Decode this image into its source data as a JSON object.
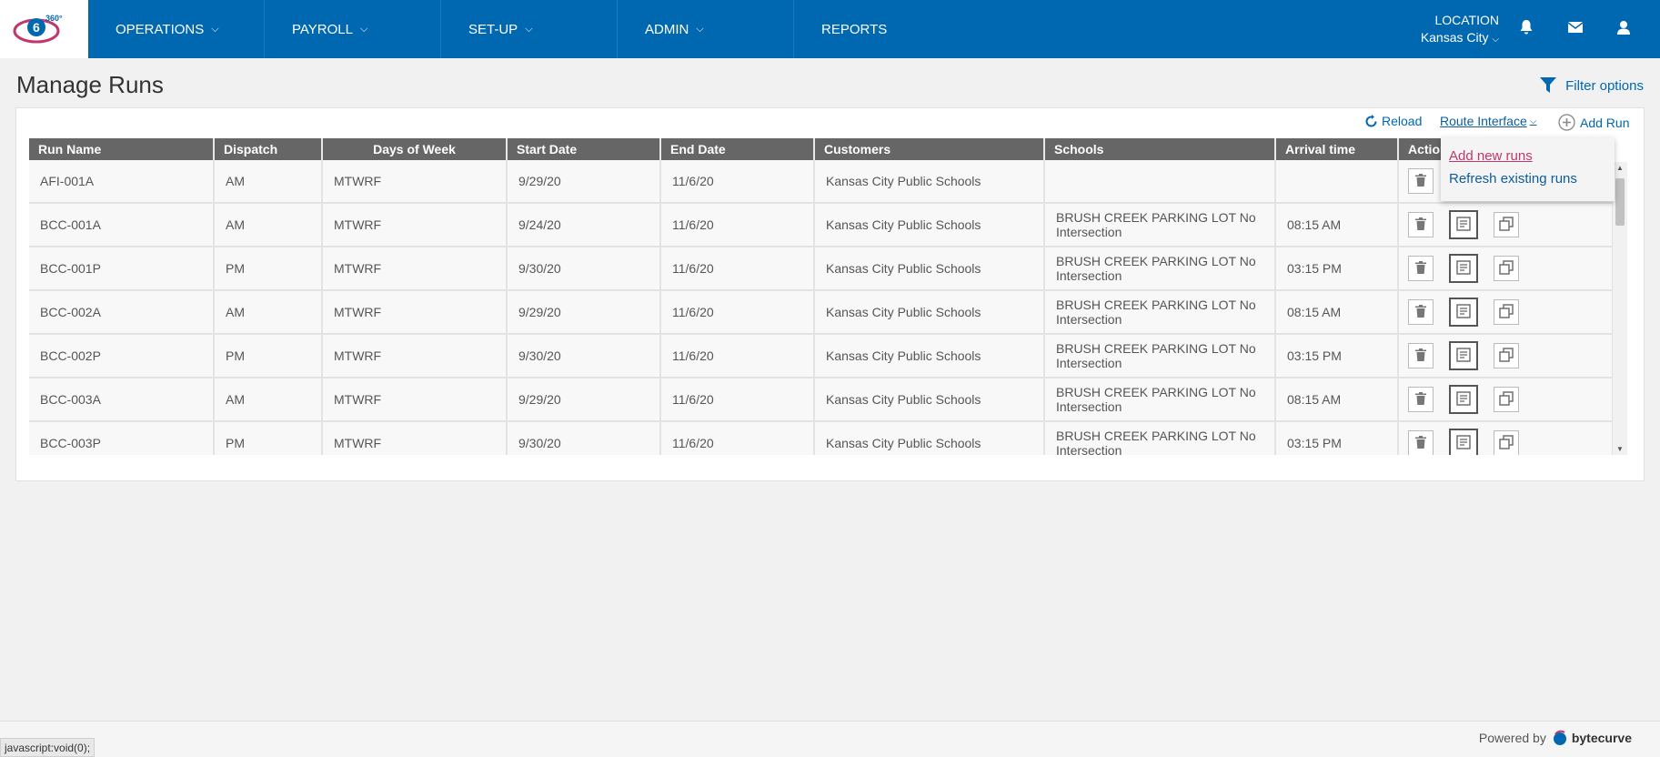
{
  "nav": {
    "items": [
      {
        "label": "OPERATIONS",
        "chevron": "⌄"
      },
      {
        "label": "PAYROLL",
        "chevron": "⌄"
      },
      {
        "label": "SET-UP",
        "chevron": "⌄"
      },
      {
        "label": "ADMIN",
        "chevron": "⌄"
      },
      {
        "label": "REPORTS",
        "chevron": ""
      }
    ],
    "location_label": "LOCATION",
    "location_value": "Kansas City",
    "icons": [
      "bell-icon",
      "mail-icon",
      "user-icon"
    ],
    "brand_color": "#0067b1"
  },
  "page": {
    "title": "Manage Runs",
    "filter_label": "Filter options"
  },
  "toolbar": {
    "reload_label": "Reload",
    "route_interface_label": "Route Interface",
    "add_run_label": "Add Run"
  },
  "dropdown": {
    "add_new": "Add new runs",
    "refresh": "Refresh existing runs"
  },
  "table": {
    "headers": [
      "Run Name",
      "Dispatch",
      "Days of Week",
      "Start Date",
      "End Date",
      "Customers",
      "Schools",
      "Arrival time",
      "Actions"
    ],
    "rows": [
      {
        "run": "AFI-001A",
        "dispatch": "AM",
        "days": "MTWRF",
        "start": "9/29/20",
        "end": "11/6/20",
        "customer": "Kansas City Public Schools",
        "school": "",
        "arrival": ""
      },
      {
        "run": "BCC-001A",
        "dispatch": "AM",
        "days": "MTWRF",
        "start": "9/24/20",
        "end": "11/6/20",
        "customer": "Kansas City Public Schools",
        "school": "BRUSH CREEK PARKING LOT No Intersection",
        "arrival": "08:15 AM"
      },
      {
        "run": "BCC-001P",
        "dispatch": "PM",
        "days": "MTWRF",
        "start": "9/30/20",
        "end": "11/6/20",
        "customer": "Kansas City Public Schools",
        "school": "BRUSH CREEK PARKING LOT No Intersection",
        "arrival": "03:15 PM"
      },
      {
        "run": "BCC-002A",
        "dispatch": "AM",
        "days": "MTWRF",
        "start": "9/29/20",
        "end": "11/6/20",
        "customer": "Kansas City Public Schools",
        "school": "BRUSH CREEK PARKING LOT No Intersection",
        "arrival": "08:15 AM"
      },
      {
        "run": "BCC-002P",
        "dispatch": "PM",
        "days": "MTWRF",
        "start": "9/30/20",
        "end": "11/6/20",
        "customer": "Kansas City Public Schools",
        "school": "BRUSH CREEK PARKING LOT No Intersection",
        "arrival": "03:15 PM"
      },
      {
        "run": "BCC-003A",
        "dispatch": "AM",
        "days": "MTWRF",
        "start": "9/29/20",
        "end": "11/6/20",
        "customer": "Kansas City Public Schools",
        "school": "BRUSH CREEK PARKING LOT No Intersection",
        "arrival": "08:15 AM"
      },
      {
        "run": "BCC-003P",
        "dispatch": "PM",
        "days": "MTWRF",
        "start": "9/30/20",
        "end": "11/6/20",
        "customer": "Kansas City Public Schools",
        "school": "BRUSH CREEK PARKING LOT No Intersection",
        "arrival": "03:15 PM"
      }
    ]
  },
  "footer": {
    "status_url": "javascript:void(0);",
    "powered_by": "Powered by",
    "brand": "bytecurve"
  }
}
